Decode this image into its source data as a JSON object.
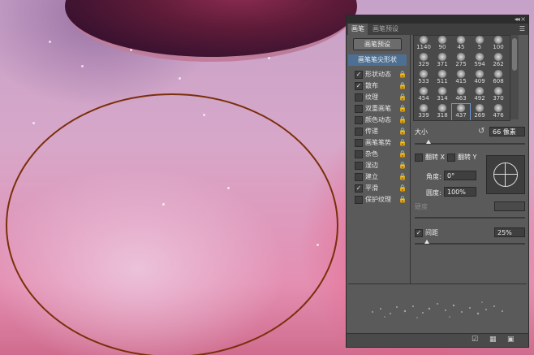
{
  "panel": {
    "tabs": [
      "画笔",
      "画笔预设"
    ],
    "preset_button": "画笔预设",
    "tip_shape": "画笔笔尖形状",
    "options": [
      {
        "label": "形状动态",
        "checked": true
      },
      {
        "label": "散布",
        "checked": true
      },
      {
        "label": "纹理",
        "checked": false
      },
      {
        "label": "双重画笔",
        "checked": false
      },
      {
        "label": "颜色动态",
        "checked": false
      },
      {
        "label": "传递",
        "checked": false
      },
      {
        "label": "画笔笔势",
        "checked": false
      },
      {
        "label": "杂色",
        "checked": false
      },
      {
        "label": "湿边",
        "checked": false
      },
      {
        "label": "建立",
        "checked": false
      },
      {
        "label": "平滑",
        "checked": true
      },
      {
        "label": "保护纹理",
        "checked": false
      }
    ],
    "brush_sizes": [
      "1140",
      "90",
      "45",
      "5",
      "100",
      "329",
      "371",
      "275",
      "594",
      "262",
      "533",
      "511",
      "415",
      "409",
      "608",
      "454",
      "314",
      "463",
      "492",
      "370",
      "339",
      "318",
      "437",
      "269",
      "476"
    ],
    "size_label": "大小",
    "size_value": "66 像素",
    "flip_x": "翻转 X",
    "flip_y": "翻转 Y",
    "angle_label": "角度:",
    "angle_value": "0°",
    "roundness_label": "圆度:",
    "roundness_value": "100%",
    "hardness_label": "硬度",
    "spacing_label": "间距",
    "spacing_checked": true,
    "spacing_value": "25%"
  }
}
